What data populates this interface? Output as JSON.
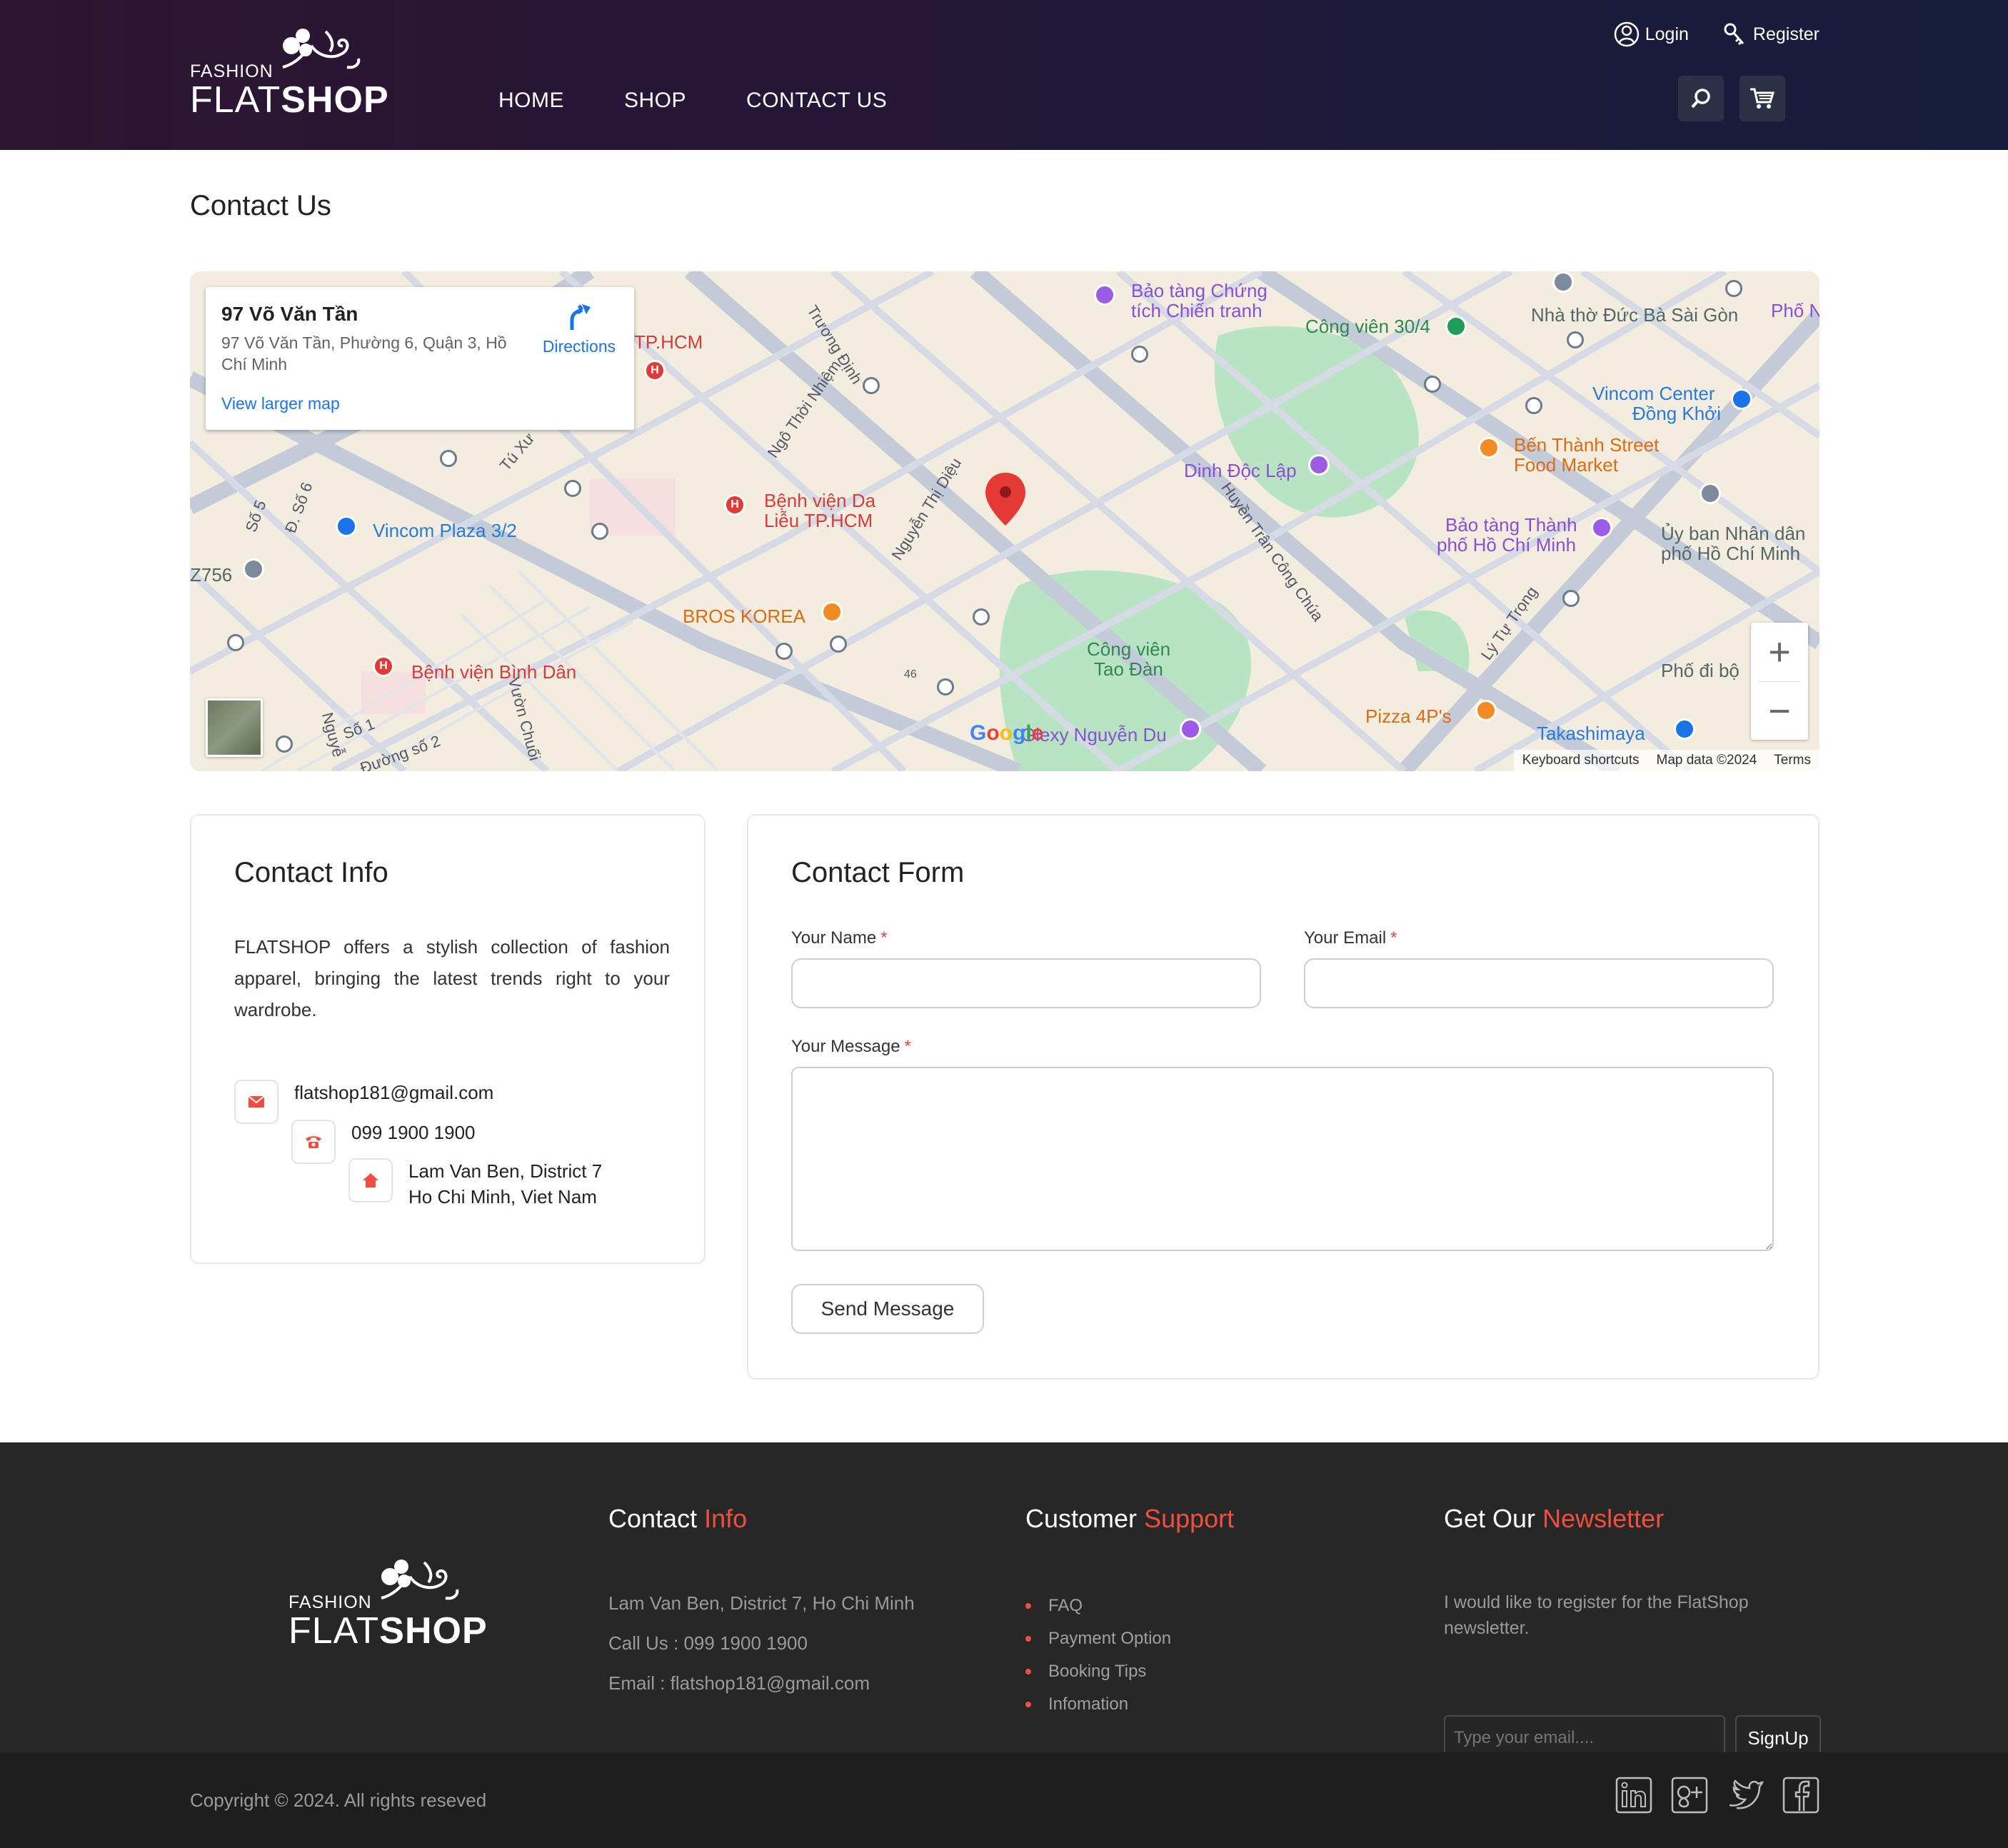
{
  "header": {
    "logo": {
      "small": "FASHION",
      "brand_a": "FLAT",
      "brand_b": "SHOP"
    },
    "nav": [
      "HOME",
      "SHOP",
      "CONTACT US"
    ],
    "login_label": "Login",
    "register_label": "Register"
  },
  "page": {
    "title": "Contact Us"
  },
  "map": {
    "card": {
      "title": "97 Võ Văn Tần",
      "address": "97 Võ Văn Tần, Phường 6, Quận 3, Hồ Chí Minh",
      "directions": "Directions",
      "larger_map": "View larger map"
    },
    "labels": {
      "bao_tang_chung": "Bảo tàng Chứng",
      "tich_chien_tranh": "tích Chiến tranh",
      "cong_vien_304": "Công viên 30/4",
      "nha_tho": "Nhà thờ Đức Bà Sài Gòn",
      "pho_n": "Phố N",
      "tphcm": "TP.HCM",
      "truong_dinh": "Trương Định",
      "ngo_thoi_nhiem": "Ngô Thời Nhiệm",
      "vincom_center": "Vincom Center",
      "dong_khoi": "Đồng Khởi",
      "ben_thanh": "Bến Thành Street",
      "food_market": "Food Market",
      "dinh_doc_lap": "Dinh Độc Lập",
      "tu_xuong": "Tú Xư",
      "benh_vien_da_lieu": "Bệnh viện Da",
      "lieu_tphcm": "Liễu TP.HCM",
      "nguyen_thi_dieu": "Nguyễn Thị Diệu",
      "huyen_tran": "Huyền Trân Công Chúa",
      "bao_tang_thanh": "Bảo tàng Thành",
      "pho_hcm": "phố Hồ Chí Minh",
      "uy_ban": "Ủy ban Nhân dân",
      "pho_hcm2": "phố Hồ Chí Minh",
      "vincom_plaza": "Vincom Plaza 3/2",
      "so5": "Số 5",
      "d_so6": "Đ. Số 6",
      "z756": "Z756",
      "bros_korea": "BROS KOREA",
      "ly_tu_trong": "Lý Tự Trọng",
      "cong_vien_tao_dan": "Công viên",
      "tao_dan": "Tao Đàn",
      "pho_di_bo": "Phố đi bộ",
      "benh_vien_binh_dan": "Bệnh viện Bình Dân",
      "so1": "Số 1",
      "duong_so2": "Đường số 2",
      "vuon_chuoi": "Vườn Chuối",
      "nguyen": "Nguyễ",
      "pizza": "Pizza 4P's",
      "takashimaya": "Takashimaya",
      "glexy": "Glexy Nguyễn Du",
      "n46": "46"
    },
    "google_logo": "Google",
    "attribution": [
      "Keyboard shortcuts",
      "Map data ©2024",
      "Terms"
    ],
    "zoom_in": "+",
    "zoom_out": "−"
  },
  "contact_info": {
    "title": "Contact Info",
    "description": "FLATSHOP offers a stylish collection of fashion apparel, bringing the latest trends right to your wardrobe.",
    "email": "flatshop181@gmail.com",
    "phone": "099 1900 1900",
    "address_line1": "Lam Van Ben, District 7",
    "address_line2": "Ho Chi Minh, Viet Nam"
  },
  "contact_form": {
    "title": "Contact Form",
    "name_label": "Your Name",
    "email_label": "Your Email",
    "message_label": "Your Message",
    "required_mark": "*",
    "name_value": "",
    "email_value": "",
    "message_value": "",
    "submit_label": "Send Message"
  },
  "footer": {
    "logo": {
      "small": "FASHION",
      "brand_a": "FLAT",
      "brand_b": "SHOP"
    },
    "contact": {
      "title_a": "Contact",
      "title_b": "Info",
      "address": "Lam Van Ben, District 7, Ho Chi Minh",
      "phone": "Call Us : 099 1900 1900",
      "email": "Email : flatshop181@gmail.com"
    },
    "support": {
      "title_a": "Customer",
      "title_b": "Support",
      "items": [
        "FAQ",
        "Payment Option",
        "Booking Tips",
        "Infomation"
      ]
    },
    "newsletter": {
      "title_a": "Get Our",
      "title_b": "Newsletter",
      "text": "I would like to register for the FlatShop newsletter.",
      "placeholder": "Type your email....",
      "button": "SignUp"
    },
    "copyright": "Copyright © 2024. All rights reseved"
  },
  "colors": {
    "accent": "#f04e3e",
    "header_start": "#2e1532",
    "header_end": "#161d3c",
    "footer_bg": "#272727"
  }
}
